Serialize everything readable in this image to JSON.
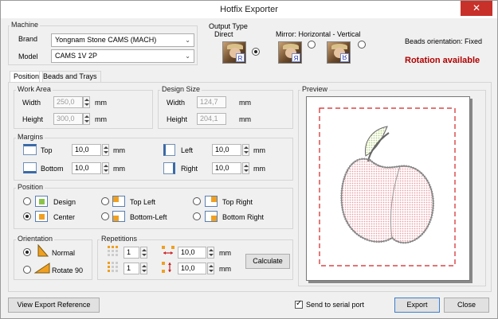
{
  "window": {
    "title": "Hotfix Exporter",
    "close_glyph": "✕"
  },
  "machine": {
    "group_label": "Machine",
    "brand_label": "Brand",
    "brand_value": "Yongnam Stone CAMS (MACH)",
    "model_label": "Model",
    "model_value": "CAMS 1V 2P"
  },
  "output_type": {
    "group_label": "Output Type",
    "direct_label": "Direct",
    "mirror_label": "Mirror: Horizontal - Vertical",
    "badges": [
      "R",
      "Я",
      "R"
    ]
  },
  "beads_orientation": "Beads orientation: Fixed",
  "rotation_available": "Rotation available",
  "tabs": [
    "Position",
    "Beads and Trays"
  ],
  "work_area": {
    "group_label": "Work Area",
    "width_label": "Width",
    "width_value": "250,0",
    "width_unit": "mm",
    "height_label": "Height",
    "height_value": "300,0",
    "height_unit": "mm"
  },
  "design_size": {
    "group_label": "Design Size",
    "width_label": "Width",
    "width_value": "124,7",
    "width_unit": "mm",
    "height_label": "Height",
    "height_value": "204,1",
    "height_unit": "mm"
  },
  "margins": {
    "group_label": "Margins",
    "top_label": "Top",
    "top_value": "10,0",
    "bottom_label": "Bottom",
    "bottom_value": "10,0",
    "left_label": "Left",
    "left_value": "10,0",
    "right_label": "Right",
    "right_value": "10,0",
    "unit": "mm"
  },
  "position": {
    "group_label": "Position",
    "options": [
      "Design",
      "Center",
      "Top Left",
      "Bottom-Left",
      "Top Right",
      "Bottom Right"
    ]
  },
  "orientation": {
    "group_label": "Orientation",
    "normal_label": "Normal",
    "rotate_label": "Rotate 90"
  },
  "repetitions": {
    "group_label": "Repetitions",
    "cols_value": "1",
    "rows_value": "1",
    "hspace_value": "10,0",
    "vspace_value": "10,0",
    "unit": "mm",
    "calculate_label": "Calculate"
  },
  "preview": {
    "group_label": "Preview"
  },
  "footer": {
    "view_reference_label": "View Export Reference",
    "send_serial_label": "Send to serial port",
    "export_label": "Export",
    "close_label": "Close"
  },
  "colors": {
    "accent_red": "#b00000",
    "close_red": "#c8302a",
    "margin_dash": "#d22222",
    "bead_pink": "#e8a0a8",
    "leaf_green": "#b6d37a"
  }
}
